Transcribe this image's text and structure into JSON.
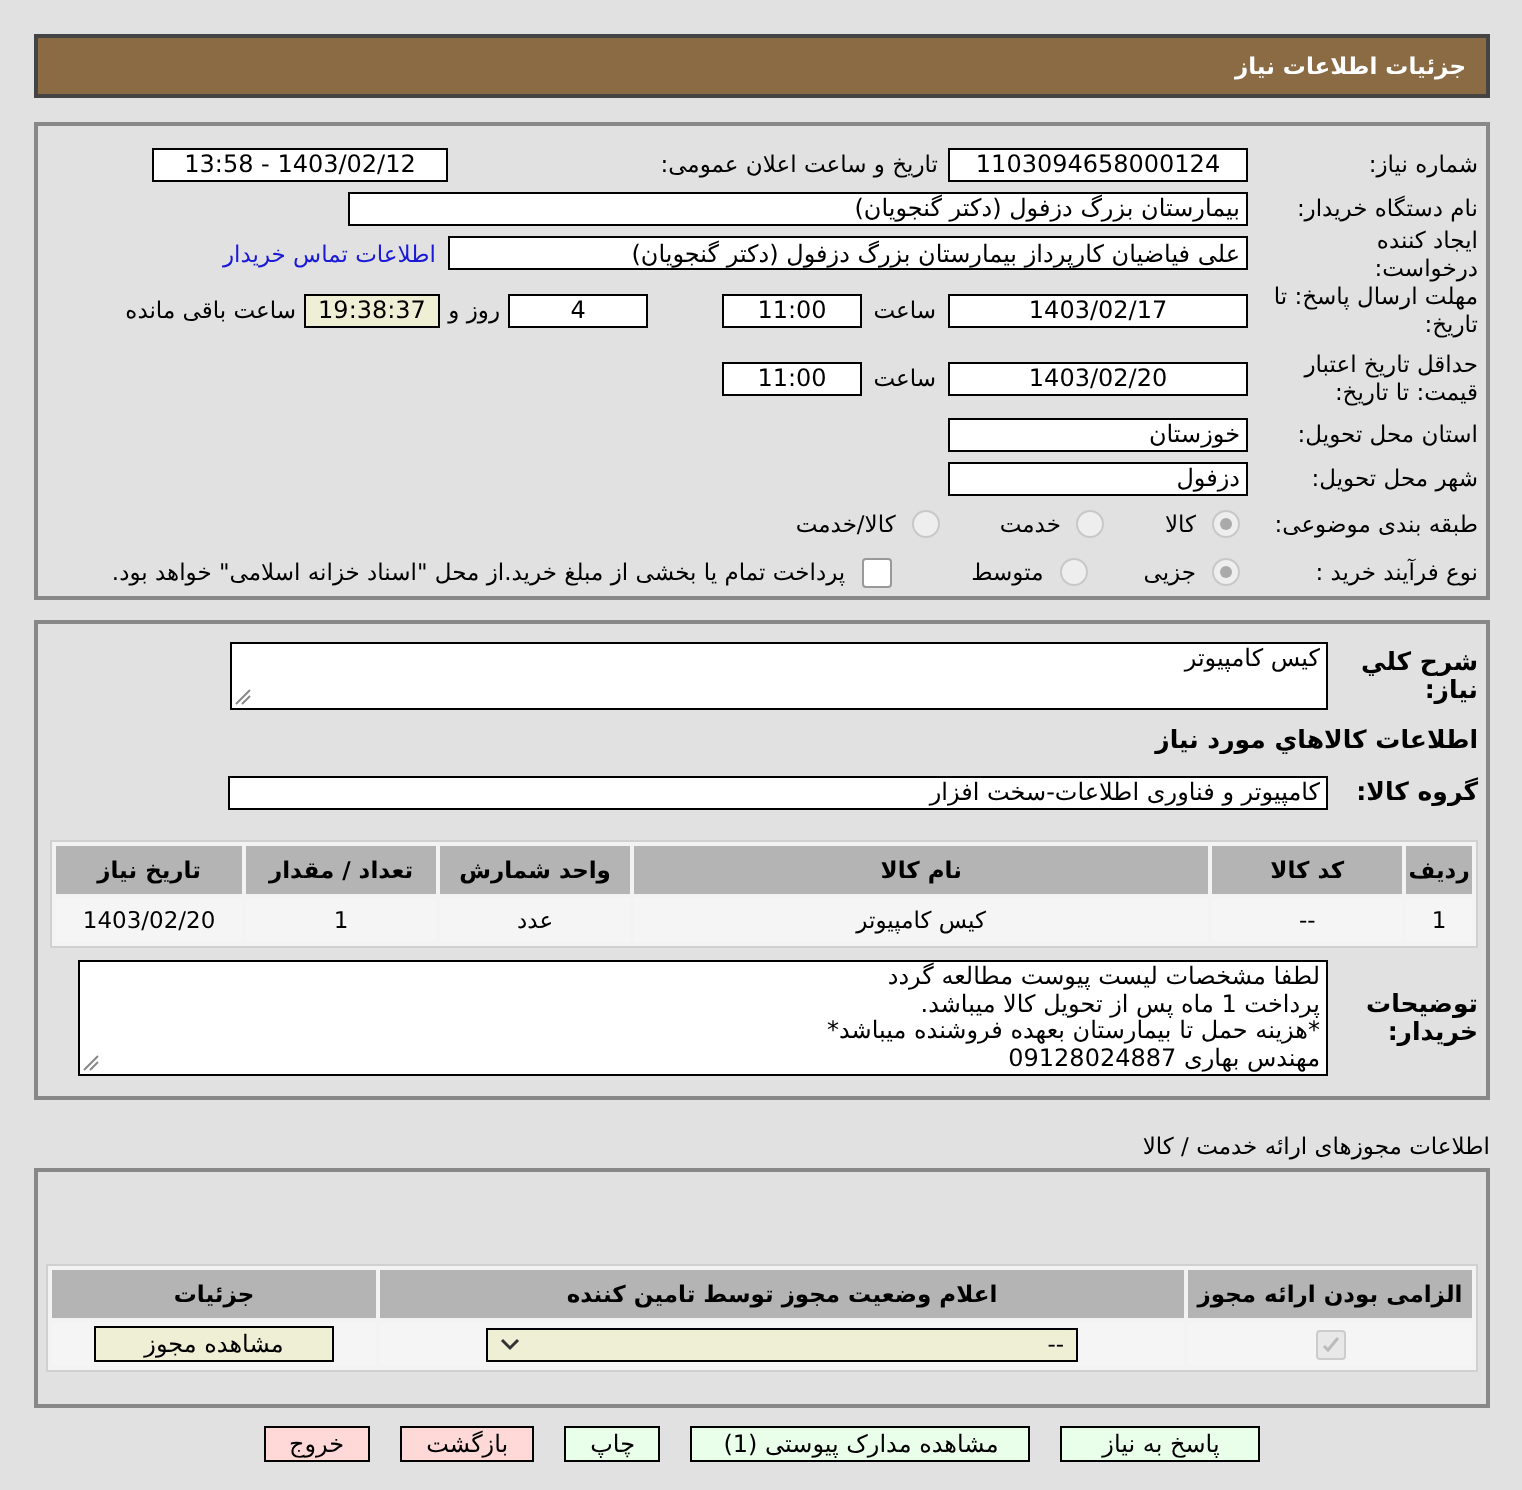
{
  "header": {
    "title": "جزئیات اطلاعات نیاز"
  },
  "need_info": {
    "need_number": {
      "label": "شماره نیاز:",
      "value": "1103094658000124"
    },
    "announce": {
      "label": "تاریخ و ساعت اعلان عمومی:",
      "value": "1403/02/12 - 13:58"
    },
    "buyer_org": {
      "label": "نام دستگاه خریدار:",
      "value": "بیمارستان بزرگ دزفول (دکتر گنجویان)"
    },
    "requester": {
      "label": "ایجاد کننده درخواست:",
      "value": "علی فیاضیان کارپرداز بیمارستان بزرگ دزفول (دکتر گنجویان)",
      "link": "اطلاعات تماس خریدار"
    },
    "deadline": {
      "label": "مهلت ارسال پاسخ: تا تاریخ:",
      "date": "1403/02/17",
      "time_label": "ساعت",
      "time": "11:00",
      "days": "4",
      "days_label": "روز و",
      "remaining": "19:38:37",
      "remaining_label": "ساعت باقی مانده"
    },
    "validity": {
      "label": "حداقل تاریخ اعتبار قیمت: تا تاریخ:",
      "date": "1403/02/20",
      "time_label": "ساعت",
      "time": "11:00"
    },
    "province": {
      "label": "استان محل تحویل:",
      "value": "خوزستان"
    },
    "city": {
      "label": "شهر محل تحویل:",
      "value": "دزفول"
    },
    "category": {
      "label": "طبقه بندی موضوعی:",
      "options": [
        {
          "label": "کالا",
          "selected": true
        },
        {
          "label": "خدمت",
          "selected": false
        },
        {
          "label": "کالا/خدمت",
          "selected": false
        }
      ]
    },
    "process": {
      "label": "نوع فرآیند خرید :",
      "options": [
        {
          "label": "جزیی",
          "selected": true
        },
        {
          "label": "متوسط",
          "selected": false
        }
      ],
      "payment": {
        "label": "پرداخت تمام یا بخشی از مبلغ خرید.از محل \"اسناد خزانه اسلامی\" خواهد بود.",
        "checked": false
      }
    }
  },
  "goods": {
    "summary_label": "شرح کلي نیاز:",
    "summary": "کیس کامپیوتر",
    "title": "اطلاعات کالاهاي مورد نیاز",
    "group_label": "گروه کالا:",
    "group": "کامپیوتر و فناوری اطلاعات-سخت افزار",
    "table": {
      "columns": [
        "ردیف",
        "کد کالا",
        "نام کالا",
        "واحد شمارش",
        "تعداد / مقدار",
        "تاریخ نیاز"
      ],
      "rows": [
        [
          "1",
          "--",
          "کیس کامپیوتر",
          "عدد",
          "1",
          "1403/02/20"
        ]
      ]
    },
    "notes_label": "توضیحات خریدار:",
    "notes": "لطفا مشخصات لیست پیوست مطالعه گردد\nپرداخت 1 ماه پس از تحویل کالا میباشد.\n*هزینه حمل تا بیمارستان بعهده فروشنده میباشد*\nمهندس بهاری 09128024887"
  },
  "licenses": {
    "title": "اطلاعات مجوزهای ارائه خدمت / کالا",
    "columns": [
      "الزامی بودن ارائه مجوز",
      "اعلام وضعیت مجوز توسط تامین کننده",
      "جزئیات"
    ],
    "rows": [
      {
        "required": {
          "checked": true,
          "disabled": true
        },
        "status": "--",
        "button": "مشاهده مجوز"
      }
    ]
  },
  "buttons": [
    {
      "label": "پاسخ به نیاز",
      "kind": "normal"
    },
    {
      "label": "مشاهده مدارک پیوستی (1)",
      "kind": "normal"
    },
    {
      "label": "چاپ",
      "kind": "normal"
    },
    {
      "label": "بازگشت",
      "kind": "danger"
    },
    {
      "label": "خروج",
      "kind": "danger"
    }
  ]
}
